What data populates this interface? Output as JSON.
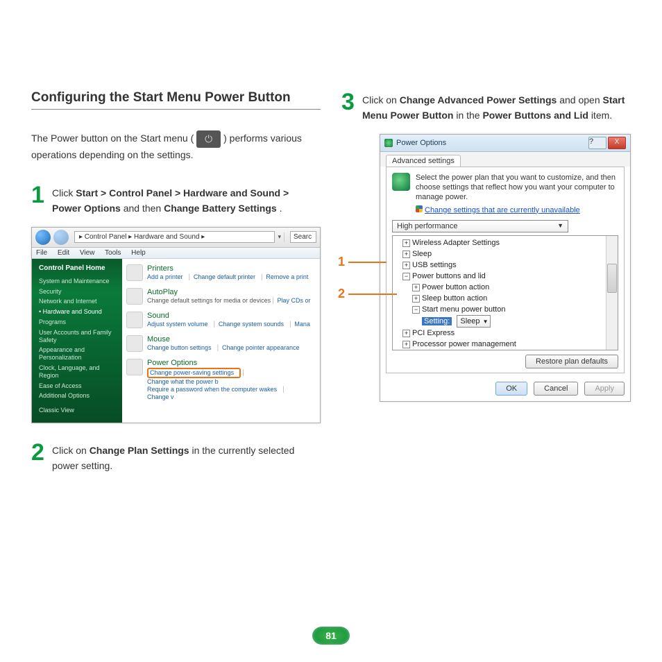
{
  "heading": "Configuring the Start Menu Power Button",
  "intro_before": "The Power button on the Start menu ( ",
  "intro_after": " ) performs various operations depending on the settings.",
  "power_icon_glyph": "⏻",
  "steps": {
    "s1": {
      "num": "1",
      "t0": "Click ",
      "b0": "Start > Control Panel > Hardware and Sound > Power Options",
      "t1": " and then ",
      "b1": "Change Battery Settings",
      "t2": "."
    },
    "s2": {
      "num": "2",
      "t0": "Click on ",
      "b0": "Change Plan Settings",
      "t1": " in the currently selected power setting."
    },
    "s3": {
      "num": "3",
      "t0": "Click on ",
      "b0": "Change Advanced Power Settings",
      "t1": " and open ",
      "b1": "Start Menu Power Button",
      "t2": " in the ",
      "b2": "Power Buttons and Lid",
      "t3": " item."
    }
  },
  "cp": {
    "breadcrumb": "▸ Control Panel ▸ Hardware and Sound ▸",
    "search_placeholder": "Searc",
    "dropdown_glyph": "▾",
    "menubar": {
      "file": "File",
      "edit": "Edit",
      "view": "View",
      "tools": "Tools",
      "help": "Help"
    },
    "side_home": "Control Panel Home",
    "side_items": [
      "System and Maintenance",
      "Security",
      "Network and Internet",
      "Hardware and Sound",
      "Programs",
      "User Accounts and Family Safety",
      "Appearance and Personalization",
      "Clock, Language, and Region",
      "Ease of Access",
      "Additional Options"
    ],
    "side_selected_index": 3,
    "side_classic": "Classic View",
    "rows": {
      "printers": {
        "title": "Printers",
        "links": [
          "Add a printer",
          "Change default printer",
          "Remove a print"
        ]
      },
      "autoplay": {
        "title": "AutoPlay",
        "sub": "Change default settings for media or devices",
        "links": [
          "Play CDs or"
        ]
      },
      "sound": {
        "title": "Sound",
        "links": [
          "Adjust system volume",
          "Change system sounds",
          "Mana"
        ]
      },
      "mouse": {
        "title": "Mouse",
        "links": [
          "Change button settings",
          "Change pointer appearance"
        ]
      },
      "power": {
        "title": "Power Options",
        "hl": "Change power-saving settings",
        "links": [
          "Change what the power b",
          "Require a password when the computer wakes",
          "Change v"
        ]
      }
    }
  },
  "po": {
    "title": "Power Options",
    "help_glyph": "?",
    "close_glyph": "X",
    "tab": "Advanced settings",
    "desc": "Select the power plan that you want to customize, and then choose settings that reflect how you want your computer to manage power.",
    "link": "Change settings that are currently unavailable",
    "plan": "High performance",
    "tree": {
      "wireless": "Wireless Adapter Settings",
      "sleep": "Sleep",
      "usb": "USB settings",
      "pbl": "Power buttons and lid",
      "pba": "Power button action",
      "sba": "Sleep button action",
      "smpb": "Start menu power button",
      "setting_label": "Setting:",
      "setting_value": "Sleep",
      "pci": "PCI Express",
      "ppm": "Processor power management"
    },
    "plus": "+",
    "minus": "−",
    "restore": "Restore plan defaults",
    "ok": "OK",
    "cancel": "Cancel",
    "apply": "Apply"
  },
  "callout1": "1",
  "callout2": "2",
  "page_number": "81"
}
